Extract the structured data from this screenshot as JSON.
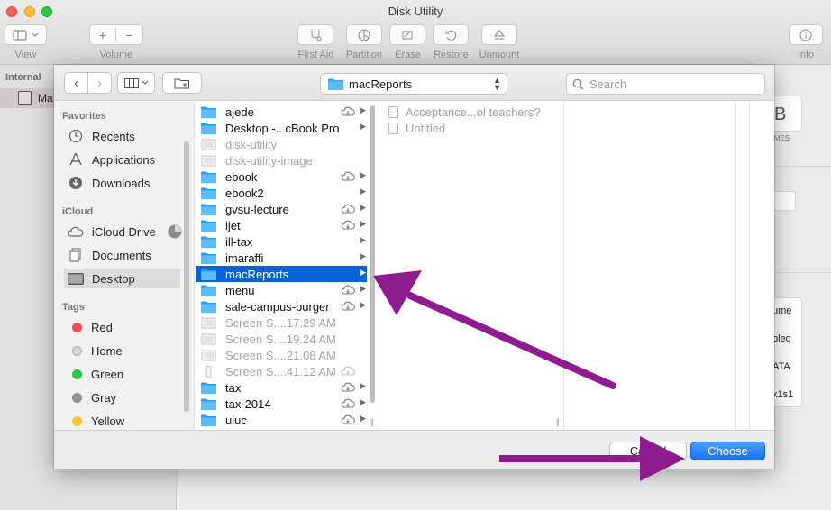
{
  "window": {
    "title": "Disk Utility"
  },
  "du_toolbar": {
    "view_label": "View",
    "volume_label": "Volume",
    "first_aid_label": "First Aid",
    "partition_label": "Partition",
    "erase_label": "Erase",
    "restore_label": "Restore",
    "unmount_label": "Unmount",
    "info_label": "Info"
  },
  "du_sidebar": {
    "section": "Internal",
    "selected_item": "Ma"
  },
  "du_main_fragments": [
    "B",
    "UMES",
    "ume",
    "bled",
    "ATA",
    "k1s1"
  ],
  "dialog": {
    "location": "macReports",
    "search_placeholder": "Search",
    "cancel_label": "Cancel",
    "choose_label": "Choose"
  },
  "sidebar": {
    "favorites_header": "Favorites",
    "favorites": [
      {
        "label": "Recents",
        "icon": "clock-icon"
      },
      {
        "label": "Applications",
        "icon": "applications-icon"
      },
      {
        "label": "Downloads",
        "icon": "download-icon"
      }
    ],
    "icloud_header": "iCloud",
    "icloud": [
      {
        "label": "iCloud Drive",
        "icon": "cloud-icon"
      },
      {
        "label": "Documents",
        "icon": "documents-icon"
      },
      {
        "label": "Desktop",
        "icon": "desktop-icon",
        "selected": true
      }
    ],
    "tags_header": "Tags",
    "tags": [
      {
        "label": "Red",
        "color": "#f1504f"
      },
      {
        "label": "Home",
        "color": "#d6d6d6"
      },
      {
        "label": "Green",
        "color": "#2fc24d"
      },
      {
        "label": "Gray",
        "color": "#8e8e93"
      },
      {
        "label": "Yellow",
        "color": "#fcc632"
      }
    ]
  },
  "column1": [
    {
      "name": "ajede",
      "type": "folder",
      "cloud": true,
      "arrow": true
    },
    {
      "name": "Desktop -...cBook Pro",
      "type": "folder",
      "cloud": false,
      "arrow": true
    },
    {
      "name": "disk-utility",
      "type": "image",
      "dim": true
    },
    {
      "name": "disk-utility-image",
      "type": "image",
      "dim": true
    },
    {
      "name": "ebook",
      "type": "folder",
      "cloud": true,
      "arrow": true
    },
    {
      "name": "ebook2",
      "type": "folder",
      "cloud": false,
      "arrow": true
    },
    {
      "name": "gvsu-lecture",
      "type": "folder",
      "cloud": true,
      "arrow": true
    },
    {
      "name": "ijet",
      "type": "folder",
      "cloud": true,
      "arrow": true
    },
    {
      "name": "ill-tax",
      "type": "folder",
      "cloud": false,
      "arrow": true
    },
    {
      "name": "imaraffi",
      "type": "folder",
      "cloud": false,
      "arrow": true
    },
    {
      "name": "macReports",
      "type": "folder",
      "cloud": false,
      "arrow": true,
      "selected": true
    },
    {
      "name": "menu",
      "type": "folder",
      "cloud": true,
      "arrow": true
    },
    {
      "name": "sale-campus-burger",
      "type": "folder",
      "cloud": true,
      "arrow": true
    },
    {
      "name": "Screen S....17.29 AM",
      "type": "image",
      "dim": true
    },
    {
      "name": "Screen S....19.24 AM",
      "type": "image",
      "dim": true
    },
    {
      "name": "Screen S....21.08 AM",
      "type": "image",
      "dim": true
    },
    {
      "name": "Screen S....41.12 AM",
      "type": "phone",
      "dim": true,
      "cloud": true
    },
    {
      "name": "tax",
      "type": "folder",
      "cloud": true,
      "arrow": true
    },
    {
      "name": "tax-2014",
      "type": "folder",
      "cloud": true,
      "arrow": true
    },
    {
      "name": "uiuc",
      "type": "folder",
      "cloud": true,
      "arrow": true
    }
  ],
  "column2": [
    {
      "name": "Acceptance...ol teachers?"
    },
    {
      "name": "Untitled"
    }
  ]
}
